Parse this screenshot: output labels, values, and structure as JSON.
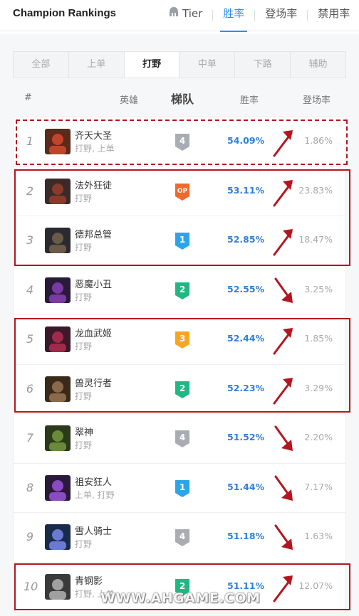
{
  "header": {
    "title": "Champion Rankings",
    "tabs": [
      {
        "label": "Tier",
        "icon": "helmet-icon",
        "active": false
      },
      {
        "label": "胜率",
        "active": true
      },
      {
        "label": "登场率",
        "active": false
      },
      {
        "label": "禁用率",
        "active": false
      }
    ]
  },
  "roles": [
    "全部",
    "上单",
    "打野",
    "中单",
    "下路",
    "辅助"
  ],
  "active_role": "打野",
  "columns": {
    "rank": "#",
    "champion": "英雄",
    "tier": "梯队",
    "winrate": "胜率",
    "pickrate": "登场率"
  },
  "rows": [
    {
      "rank": "1",
      "name": "齐天大圣",
      "positions": "打野, 上单",
      "tier": "4",
      "winrate": "54.09%",
      "pickrate": "1.86%",
      "trend": "up"
    },
    {
      "rank": "2",
      "name": "法外狂徒",
      "positions": "打野",
      "tier": "OP",
      "winrate": "53.11%",
      "pickrate": "23.83%",
      "trend": "up"
    },
    {
      "rank": "3",
      "name": "德邦总管",
      "positions": "打野",
      "tier": "1",
      "winrate": "52.85%",
      "pickrate": "18.47%",
      "trend": "up"
    },
    {
      "rank": "4",
      "name": "恶魔小丑",
      "positions": "打野",
      "tier": "2",
      "winrate": "52.55%",
      "pickrate": "3.25%",
      "trend": "down"
    },
    {
      "rank": "5",
      "name": "龙血武姬",
      "positions": "打野",
      "tier": "3",
      "winrate": "52.44%",
      "pickrate": "1.85%",
      "trend": "up"
    },
    {
      "rank": "6",
      "name": "兽灵行者",
      "positions": "打野",
      "tier": "2",
      "winrate": "52.23%",
      "pickrate": "3.29%",
      "trend": "up"
    },
    {
      "rank": "7",
      "name": "翠神",
      "positions": "打野",
      "tier": "4",
      "winrate": "51.52%",
      "pickrate": "2.20%",
      "trend": "down"
    },
    {
      "rank": "8",
      "name": "祖安狂人",
      "positions": "上单, 打野",
      "tier": "1",
      "winrate": "51.44%",
      "pickrate": "7.17%",
      "trend": "down"
    },
    {
      "rank": "9",
      "name": "雪人骑士",
      "positions": "打野",
      "tier": "4",
      "winrate": "51.18%",
      "pickrate": "1.63%",
      "trend": "down"
    },
    {
      "rank": "10",
      "name": "青钢影",
      "positions": "打野, 上单",
      "tier": "2",
      "winrate": "51.11%",
      "pickrate": "12.07%",
      "trend": "up"
    }
  ],
  "colors": {
    "accent": "#2d8cf0",
    "winrate": "#2f7fd8",
    "highlight": "#b5151f",
    "tier_op": "#f0692d",
    "tier_1": "#2aa6e8",
    "tier_2": "#20b882",
    "tier_3": "#f5a623",
    "tier_4": "#a9adb3"
  },
  "watermark": "WWW.AHGAME.COM"
}
